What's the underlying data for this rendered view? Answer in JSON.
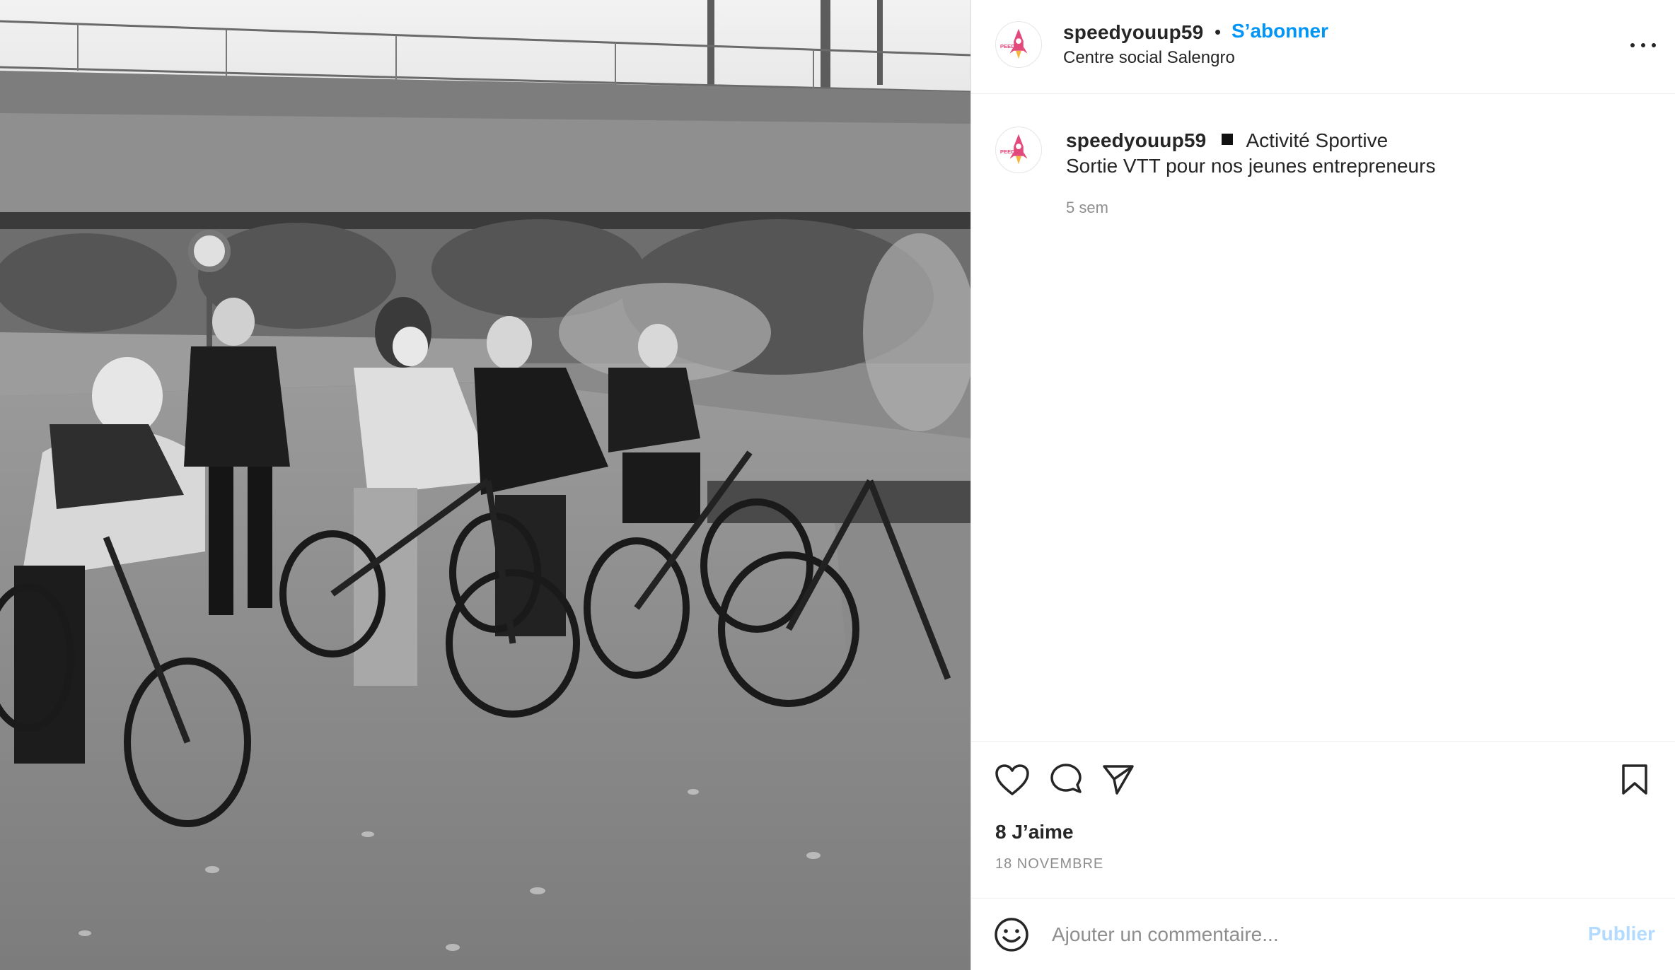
{
  "post": {
    "username": "speedyouup59",
    "separator": "•",
    "follow_label": "S’abonner",
    "location": "Centre social Salengro",
    "caption": {
      "username": "speedyouup59",
      "line1": "Activité Sportive",
      "line2": "Sortie VTT pour nos jeunes entrepreneurs",
      "time_ago": "5 sem"
    },
    "likes": "8 J’aime",
    "date": "18 NOVEMBRE"
  },
  "comment_box": {
    "placeholder": "Ajouter un commentaire...",
    "publish_label": "Publier"
  },
  "photo": {
    "description_icon": "group-bike-photo"
  },
  "colors": {
    "accent": "#0095f6",
    "publish_disabled": "#b3dbff",
    "muted": "#8e8e8e",
    "text": "#262626",
    "avatar_pink": "#e3487b",
    "avatar_yellow": "#f2b73b"
  }
}
